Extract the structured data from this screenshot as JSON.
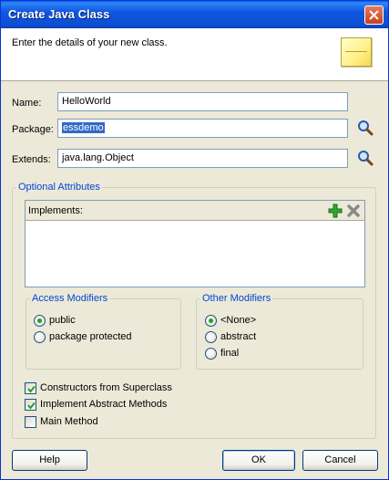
{
  "window": {
    "title": "Create Java Class"
  },
  "header": {
    "description": "Enter the details of your new class."
  },
  "form": {
    "name_label": "Name:",
    "name_value": "HelloWorld",
    "package_label": "Package:",
    "package_value": "essdemo",
    "extends_label": "Extends:",
    "extends_value": "java.lang.Object"
  },
  "optional_attributes": {
    "legend": "Optional Attributes",
    "implements_label": "Implements:",
    "access_modifiers": {
      "legend": "Access Modifiers",
      "options": [
        {
          "label": "public",
          "selected": true
        },
        {
          "label": "package protected",
          "selected": false
        }
      ]
    },
    "other_modifiers": {
      "legend": "Other Modifiers",
      "options": [
        {
          "label": "<None>",
          "selected": true
        },
        {
          "label": "abstract",
          "selected": false
        },
        {
          "label": "final",
          "selected": false
        }
      ]
    },
    "checkboxes": [
      {
        "label": "Constructors from Superclass",
        "checked": true
      },
      {
        "label": "Implement Abstract Methods",
        "checked": true
      },
      {
        "label": "Main Method",
        "checked": false
      }
    ]
  },
  "buttons": {
    "help": "Help",
    "ok": "OK",
    "cancel": "Cancel"
  },
  "colors": {
    "title_bar": "#0b4fd4",
    "selection": "#316ac5",
    "legend_text": "#0046d5",
    "radio_dot": "#21a121"
  }
}
